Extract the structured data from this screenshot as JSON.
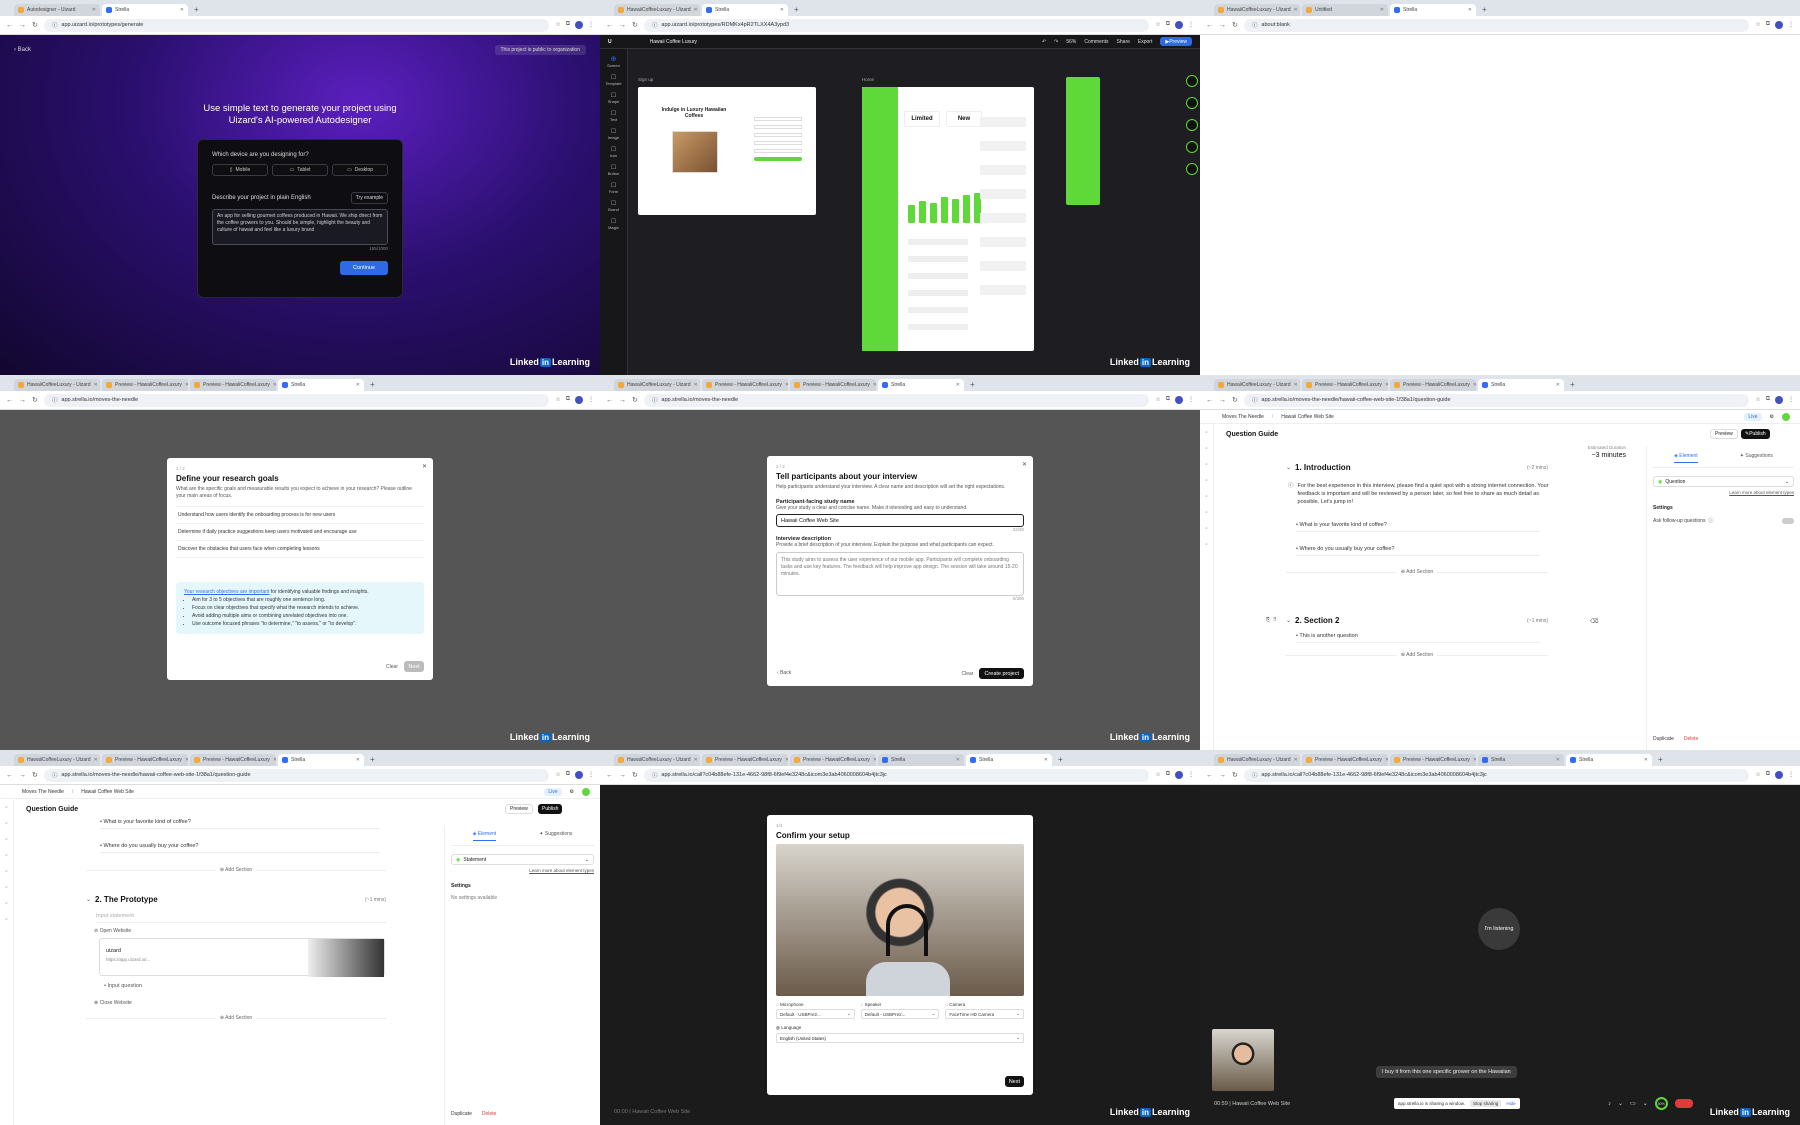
{
  "panes": [
    {
      "tabs": [
        "Autodesigner - Uizard",
        "Strella"
      ],
      "url": "app.uizard.io/prototypes/generate",
      "back": "Back",
      "public_badge": "This project is public to organization",
      "headline": "Use simple text to generate your project using Uizard's AI-powered Autodesigner",
      "device_q": "Which device are you designing for?",
      "devices": [
        "Mobile",
        "Tablet",
        "Desktop"
      ],
      "describe": "Describe your project in plain English",
      "try_example": "Try example",
      "prompt": "An app for selling gourmet coffees produced in Hawaii. We ship direct from the coffee growers to you. Should be simple, highlight the beauty and culture of hawaii and feel like a luxury brand",
      "count": "155/1000",
      "continue": "Continue"
    },
    {
      "tabs": [
        "HawaiiCoffeeLuxury - Uizard",
        "Strella"
      ],
      "url": "app.uizard.io/prototypes/RDMKx4pR2TLXX4A3ypd3",
      "project": "Hawaii Coffee Luxury",
      "zoom": "56%",
      "top_actions": [
        "Comments",
        "Share",
        "Export"
      ],
      "preview": "Preview",
      "left_tools": [
        "Screen",
        "Template",
        "Shape",
        "Text",
        "Image",
        "Icon",
        "Button",
        "Form",
        "Brand",
        "Magic"
      ],
      "sign_up": "Sign up",
      "screen2": "Home",
      "hero": "Indulge in Luxury Hawaiian Coffees",
      "stat1": "Limited",
      "stat2": "New"
    },
    {
      "tabs": [
        "HawaiiCoffeeLuxury - Uizard",
        "Untitled",
        "Strella"
      ],
      "url": "about:blank"
    },
    {
      "tabs": [
        "HawaiiCoffeeLuxury - Uizard",
        "Preview - HawaiiCoffeeLuxury",
        "Preview - HawaiiCoffeeLuxury",
        "Strella"
      ],
      "url": "app.strella.io/moves-the-needle",
      "step": "1 / 2",
      "title": "Define your research goals",
      "subtitle": "What are the specific goals and measurable results you expect to achieve in your research? Please outline your main areas of focus.",
      "goals": [
        "Understand how users identify the onboarding process is for new users",
        "Determine if daily practice suggestions keep users motivated and encourage use",
        "Discover the obstacles that users face when completing lessons"
      ],
      "tip_lead": "Your research objectives are important",
      "tip_rest": " for identifying valuable findings and insights.",
      "tips": [
        "Aim for 3 to 5 objectives that are roughly one sentence long.",
        "Focus on clear objectives that specify what the research intends to achieve.",
        "Avoid adding multiple aims or combining unrelated objectives into one.",
        "Use outcome focused phrases \"to determine,\" \"to assess,\" or \"to develop\"."
      ],
      "clear": "Clear",
      "next": "Next"
    },
    {
      "tabs": [
        "HawaiiCoffeeLuxury - Uizard",
        "Preview - HawaiiCoffeeLuxury",
        "Preview - HawaiiCoffeeLuxury",
        "Strella"
      ],
      "url": "app.strella.io/moves-the-needle",
      "step": "2 / 2",
      "title": "Tell participants about your interview",
      "subtitle": "Help participants understand your interview. A clear name and description will set the right expectations.",
      "name_label": "Participant-facing study name",
      "name_help": "Give your study a clear and concise name. Make it interesting and easy to understand.",
      "name_value": "Hawaii Coffee Web Site",
      "name_count": "22/30",
      "desc_label": "Interview description",
      "desc_help": "Provide a brief description of your interview. Explain the purpose and what participants can expect.",
      "desc_value": "This study aims to assess the user experience of our mobile app. Participants will complete onboarding tasks and use key features. The feedback will help improve app design. The session will take around 15-20 minutes.",
      "desc_count": "0/300",
      "back": "Back",
      "clear": "Clear",
      "create": "Create project"
    },
    {
      "tabs": [
        "HawaiiCoffeeLuxury - Uizard",
        "Preview - HawaiiCoffeeLuxury",
        "Preview - HawaiiCoffeeLuxury",
        "Strella"
      ],
      "url": "app.strella.io/moves-the-needle/hawaii-coffee-web-site-1f38a1/question-guide",
      "crumb1": "Moves The Needle",
      "crumb2": "Hawaii Coffee Web Site",
      "live": "Live",
      "page_title": "Question Guide",
      "preview": "Preview",
      "publish": "Publish",
      "est_label": "Estimated Duration",
      "est_value": "~3 minutes",
      "s1_title": "1. Introduction",
      "s1_time": "(~2 mins)",
      "s1_text": "For the best experience in this interview, please find a quiet spot with a strong internet connection. Your feedback is important and will be reviewed by a person later, so feel free to share as much detail as possible. Let's jump in!",
      "q1": "What is your favorite kind of coffee?",
      "q2": "Where do you usually buy your coffee?",
      "add_section": "Add Section",
      "s2_title": "2. Section 2",
      "s2_time": "(~1 mins)",
      "q3": "This is another question",
      "tab_element": "Element",
      "tab_suggestions": "Suggestions",
      "el_type": "Question",
      "learn": "Learn more about element types",
      "settings": "Settings",
      "followups": "Ask follow-up questions",
      "duplicate": "Duplicate",
      "delete": "Delete"
    },
    {
      "tabs": [
        "HawaiiCoffeeLuxury - Uizard",
        "Preview - HawaiiCoffeeLuxury",
        "Preview - HawaiiCoffeeLuxury",
        "Strella"
      ],
      "url": "app.strella.io/moves-the-needle/hawaii-coffee-web-site-1f38a1/question-guide",
      "crumb1": "Moves The Needle",
      "crumb2": "Hawaii Coffee Web Site",
      "live": "Live",
      "page_title": "Question Guide",
      "preview": "Preview",
      "publish": "Publish",
      "q1": "What is your favorite kind of coffee?",
      "q2": "Where do you usually buy your coffee?",
      "add_section": "Add Section",
      "s2_title": "2. The Prototype",
      "s2_time": "(~1 mins)",
      "input_statement": "Input statement",
      "open_website": "Open Website",
      "site_name": "uizard",
      "site_url": "https://app.uizard.io/...",
      "input_question": "Input question",
      "close_website": "Close Website",
      "tab_element": "Element",
      "tab_suggestions": "Suggestions",
      "el_type": "Statement",
      "learn": "Learn more about element types",
      "settings": "Settings",
      "no_settings": "No settings available",
      "duplicate": "Duplicate",
      "delete": "Delete"
    },
    {
      "tabs": [
        "HawaiiCoffeeLuxury - Uizard",
        "Preview - HawaiiCoffeeLuxury",
        "Preview - HawaiiCoffeeLuxury",
        "Strella",
        "Strella"
      ],
      "url": "app.strella.io/call?c04b88efe-131e-4662-98f8-6f9ef4e3248c&icom3e3ab4060008604b4jtc3jc",
      "step": "1/4",
      "title": "Confirm your setup",
      "mic_label": "Microphone",
      "mic": "Default - USBPre2...",
      "spk_label": "Speaker",
      "spk": "Default - USBPre2...",
      "cam_label": "Camera",
      "cam": "FaceTime HD Camera",
      "lang_label": "Language",
      "lang": "English (United States)",
      "next": "Next",
      "footer": "00:00 | Hawaii Coffee Web Site"
    },
    {
      "tabs": [
        "HawaiiCoffeeLuxury - Uizard",
        "Preview - HawaiiCoffeeLuxury",
        "Preview - HawaiiCoffeeLuxury",
        "Strella",
        "Strella"
      ],
      "url": "app.strella.io/call?c04b88efe-131e-4662-98f8-6f9ef4e3248c&icom3e3ab4060008604b4jtc3jc",
      "listening": "I'm listening",
      "caption": "I buy it from this one specific grower on the Hawaiian",
      "timer": "00:59 | Hawaii Coffee Web Site",
      "sharing": "app.strella.io is sharing a window.",
      "stop": "Stop sharing",
      "hide": "Hide",
      "pct": "50%"
    }
  ],
  "brand": {
    "li_text": "Linked",
    "li_box": "in",
    "li_tail": "Learning"
  },
  "colors": {
    "strella_blue": "#2f6df3",
    "uizard_blue": "#2d6ae3",
    "green": "#5fd83a",
    "red": "#e03a3a"
  }
}
